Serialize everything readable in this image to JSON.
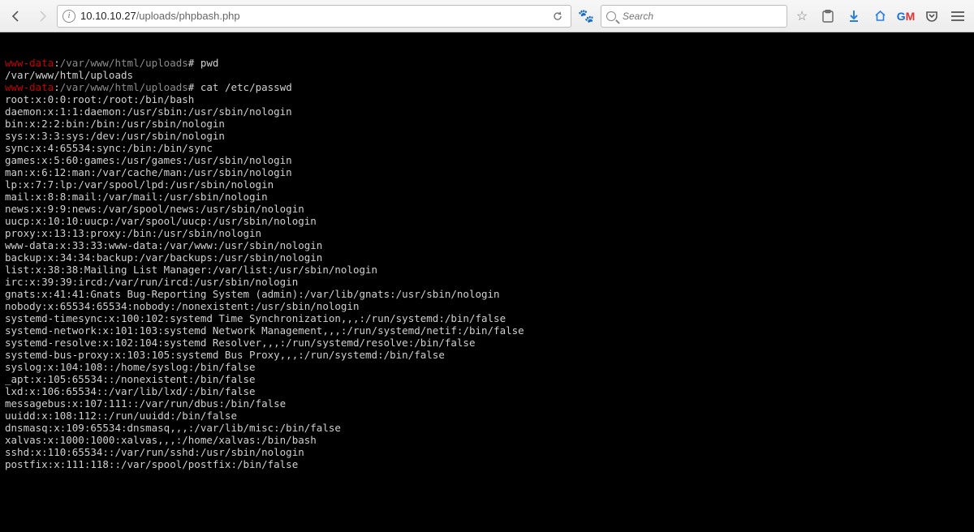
{
  "browser": {
    "url_prefix": "",
    "url_host": "10.10.10.27",
    "url_path": "/uploads/phpbash.php",
    "search_placeholder": "Search"
  },
  "terminal": {
    "prompt_user": "www-data",
    "prompt_sep": ":",
    "prompt_path": "/var/www/html/uploads",
    "prompt_end": "#",
    "entries": [
      {
        "command": "pwd",
        "output": [
          "/var/www/html/uploads"
        ]
      },
      {
        "command": "cat /etc/passwd",
        "output": [
          "root:x:0:0:root:/root:/bin/bash",
          "daemon:x:1:1:daemon:/usr/sbin:/usr/sbin/nologin",
          "bin:x:2:2:bin:/bin:/usr/sbin/nologin",
          "sys:x:3:3:sys:/dev:/usr/sbin/nologin",
          "sync:x:4:65534:sync:/bin:/bin/sync",
          "games:x:5:60:games:/usr/games:/usr/sbin/nologin",
          "man:x:6:12:man:/var/cache/man:/usr/sbin/nologin",
          "lp:x:7:7:lp:/var/spool/lpd:/usr/sbin/nologin",
          "mail:x:8:8:mail:/var/mail:/usr/sbin/nologin",
          "news:x:9:9:news:/var/spool/news:/usr/sbin/nologin",
          "uucp:x:10:10:uucp:/var/spool/uucp:/usr/sbin/nologin",
          "proxy:x:13:13:proxy:/bin:/usr/sbin/nologin",
          "www-data:x:33:33:www-data:/var/www:/usr/sbin/nologin",
          "backup:x:34:34:backup:/var/backups:/usr/sbin/nologin",
          "list:x:38:38:Mailing List Manager:/var/list:/usr/sbin/nologin",
          "irc:x:39:39:ircd:/var/run/ircd:/usr/sbin/nologin",
          "gnats:x:41:41:Gnats Bug-Reporting System (admin):/var/lib/gnats:/usr/sbin/nologin",
          "nobody:x:65534:65534:nobody:/nonexistent:/usr/sbin/nologin",
          "systemd-timesync:x:100:102:systemd Time Synchronization,,,:/run/systemd:/bin/false",
          "systemd-network:x:101:103:systemd Network Management,,,:/run/systemd/netif:/bin/false",
          "systemd-resolve:x:102:104:systemd Resolver,,,:/run/systemd/resolve:/bin/false",
          "systemd-bus-proxy:x:103:105:systemd Bus Proxy,,,:/run/systemd:/bin/false",
          "syslog:x:104:108::/home/syslog:/bin/false",
          "_apt:x:105:65534::/nonexistent:/bin/false",
          "lxd:x:106:65534::/var/lib/lxd/:/bin/false",
          "messagebus:x:107:111::/var/run/dbus:/bin/false",
          "uuidd:x:108:112::/run/uuidd:/bin/false",
          "dnsmasq:x:109:65534:dnsmasq,,,:/var/lib/misc:/bin/false",
          "xalvas:x:1000:1000:xalvas,,,:/home/xalvas:/bin/bash",
          "sshd:x:110:65534::/var/run/sshd:/usr/sbin/nologin",
          "postfix:x:111:118::/var/spool/postfix:/bin/false"
        ]
      }
    ]
  }
}
